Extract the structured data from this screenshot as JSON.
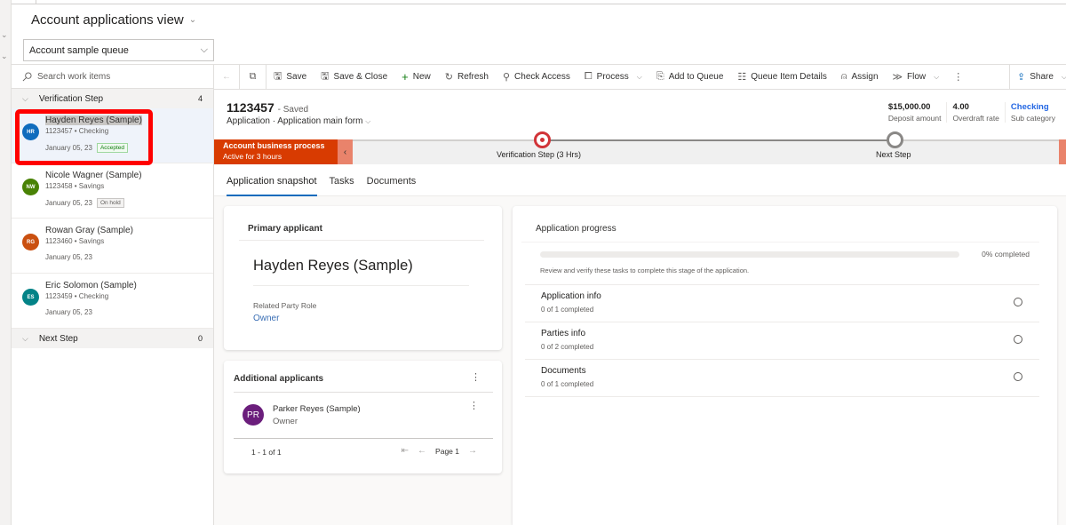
{
  "view": {
    "title": "Account applications view",
    "queue_selected": "Account sample queue"
  },
  "worklist": {
    "search_placeholder": "Search work items",
    "groups": [
      {
        "name": "Verification Step",
        "count": "4"
      },
      {
        "name": "Next Step",
        "count": "0"
      }
    ],
    "items": [
      {
        "initials": "HR",
        "name": "Hayden Reyes (Sample)",
        "sub": "1123457 • Checking",
        "date": "January 05, 23",
        "badge": "Accepted",
        "avatar_color": "#0f6cbd"
      },
      {
        "initials": "NW",
        "name": "Nicole Wagner (Sample)",
        "sub": "1123458 • Savings",
        "date": "January 05, 23",
        "badge": "On hold",
        "avatar_color": "#498205"
      },
      {
        "initials": "RG",
        "name": "Rowan Gray (Sample)",
        "sub": "1123460 • Savings",
        "date": "January 05, 23",
        "badge": "",
        "avatar_color": "#ca5010"
      },
      {
        "initials": "ES",
        "name": "Eric Solomon (Sample)",
        "sub": "1123459 • Checking",
        "date": "January 05, 23",
        "badge": "",
        "avatar_color": "#038387"
      }
    ]
  },
  "commands": {
    "save": "Save",
    "save_close": "Save & Close",
    "new": "New",
    "refresh": "Refresh",
    "check_access": "Check Access",
    "process": "Process",
    "add_to_queue": "Add to Queue",
    "queue_item_details": "Queue Item Details",
    "assign": "Assign",
    "flow": "Flow",
    "share": "Share"
  },
  "record": {
    "id": "1123457",
    "status": "- Saved",
    "entity": "Application",
    "form": "Application main form",
    "kpis": [
      {
        "value": "$15,000.00",
        "label": "Deposit amount"
      },
      {
        "value": "4.00",
        "label": "Overdraft rate"
      },
      {
        "value": "Checking",
        "label": "Sub category"
      }
    ]
  },
  "process": {
    "name": "Account business process",
    "duration": "Active for 3 hours",
    "stages": [
      {
        "label": "Verification Step  (3 Hrs)",
        "state": "active"
      },
      {
        "label": "Next Step",
        "state": "pending"
      }
    ]
  },
  "tabs": [
    "Application snapshot",
    "Tasks",
    "Documents"
  ],
  "primary_applicant": {
    "heading": "Primary applicant",
    "name": "Hayden Reyes (Sample)",
    "role_label": "Related Party Role",
    "role_value": "Owner"
  },
  "additional_applicants": {
    "heading": "Additional applicants",
    "rows": [
      {
        "initials": "PR",
        "name": "Parker Reyes (Sample)",
        "role": "Owner"
      }
    ],
    "count_text": "1 - 1 of 1",
    "page_text": "Page 1"
  },
  "progress": {
    "heading": "Application progress",
    "percent": 0,
    "percent_text": "0% completed",
    "description": "Review and verify these tasks to complete this stage of the application.",
    "tasks": [
      {
        "name": "Application info",
        "status": "0 of 1 completed"
      },
      {
        "name": "Parties info",
        "status": "0 of 2 completed"
      },
      {
        "name": "Documents",
        "status": "0 of 1 completed"
      }
    ]
  }
}
